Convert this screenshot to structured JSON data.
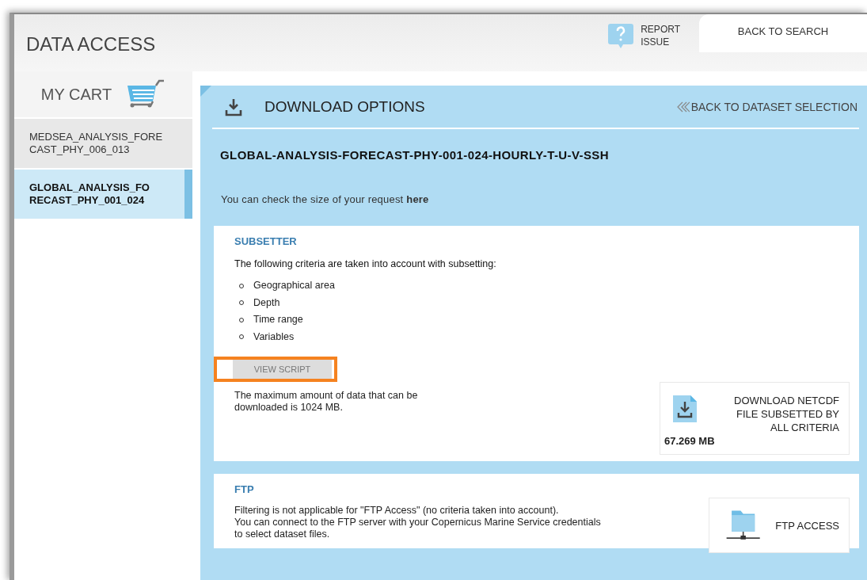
{
  "header": {
    "title": "DATA ACCESS",
    "report_issue": "REPORT\nISSUE",
    "back_to_search": "BACK TO SEARCH"
  },
  "cart": {
    "title": "MY CART",
    "items": [
      {
        "label": "MEDSEA_ANALYSIS_FORE\nCAST_PHY_006_013",
        "selected": false
      },
      {
        "label": "GLOBAL_ANALYSIS_FO\nRECAST_PHY_001_024",
        "selected": true
      }
    ]
  },
  "panel": {
    "title": "DOWNLOAD OPTIONS",
    "back_link": "BACK TO DATASET SELECTION",
    "dataset": "GLOBAL-ANALYSIS-FORECAST-PHY-001-024-HOURLY-T-U-V-SSH",
    "size_note": "You can check the size of your request **here**"
  },
  "subsetter": {
    "heading": "SUBSETTER",
    "intro": "The following criteria are taken into account with subsetting:",
    "criteria": [
      "Geographical area",
      "Depth",
      "Time range",
      "Variables"
    ],
    "view_script": {
      "label": "VIEW SCRIPT",
      "highlighted": true,
      "disabled": true
    },
    "limit_note": "The maximum amount of data that can be\ndownloaded is 1024 MB.",
    "download": {
      "label": "DOWNLOAD NETCDF\nFILE SUBSETTED BY\nALL CRITERIA",
      "size": "67.269 MB"
    }
  },
  "ftp": {
    "heading": "FTP",
    "note": "Filtering is not applicable for \"FTP Access\" (no criteria taken into account).\nYou can connect to the FTP server with your Copernicus Marine Service credentials\nto select dataset files.",
    "button": "FTP ACCESS"
  }
}
